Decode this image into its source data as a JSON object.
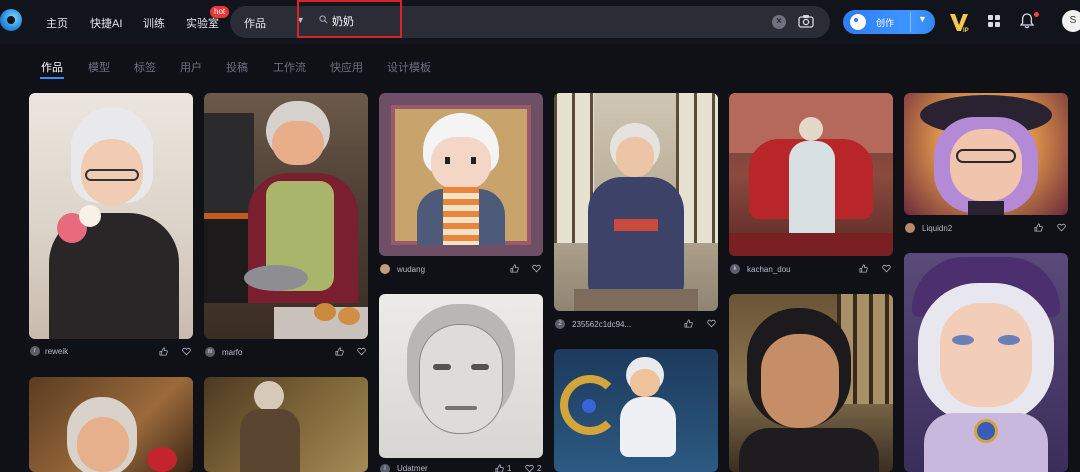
{
  "nav": {
    "home": "主页",
    "quick_ai": "快捷AI",
    "train": "训练",
    "lab": "实验室",
    "hot_badge": "hot"
  },
  "search": {
    "type": "作品",
    "query": "奶奶"
  },
  "header": {
    "create": "创作",
    "avatar_letter": "S"
  },
  "tabs": [
    "作品",
    "模型",
    "标签",
    "用户",
    "投稿",
    "工作流",
    "快应用",
    "设计模板"
  ],
  "cards": [
    {
      "author": "reweik",
      "initial": "r"
    },
    {
      "author": "marfo",
      "initial": "m"
    },
    {
      "author": "wudang",
      "initial": ""
    },
    {
      "author": "235562c1dc94...",
      "initial": "2"
    },
    {
      "author": "kachan_dou",
      "initial": "k"
    },
    {
      "author": "Liquidn2",
      "initial": ""
    },
    {
      "author": "Udatmer",
      "initial": "l",
      "likes": "1",
      "hearts": "2"
    }
  ],
  "colors": {
    "background": "#0f1117",
    "topbar": "#12141c",
    "accent": "#3a8cff",
    "highlight": "#d9232a"
  }
}
